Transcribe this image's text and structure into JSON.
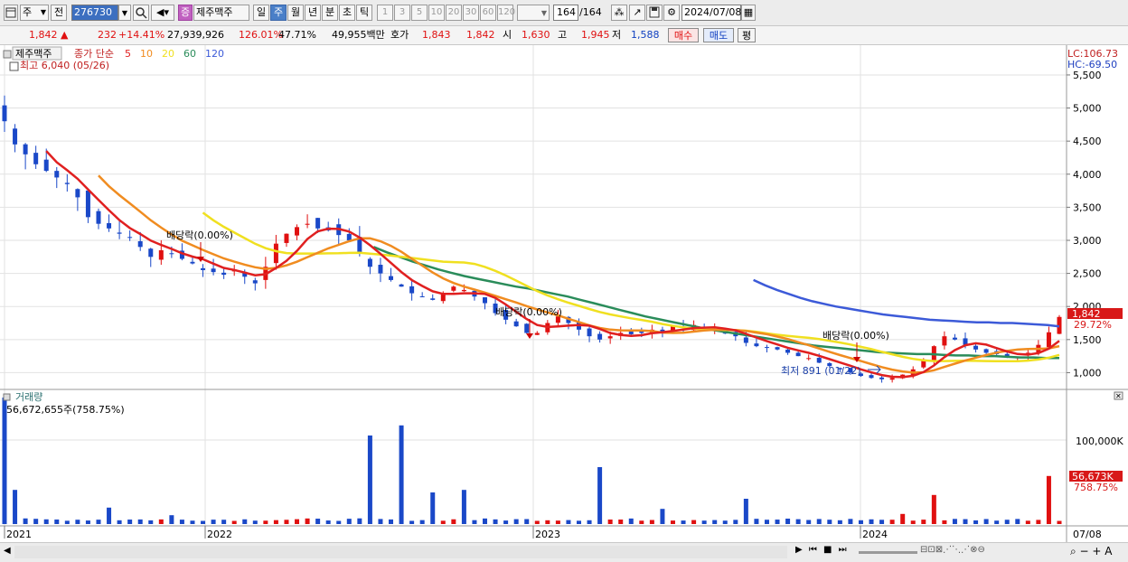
{
  "toolbar": {
    "market_select": "주",
    "prev_label": "전",
    "code": "276730",
    "stock_tag": "증",
    "stock_name": "제주맥주",
    "period_tabs": [
      "일",
      "주",
      "월",
      "년",
      "분",
      "초",
      "틱"
    ],
    "active_period": "주",
    "interval_buttons": [
      "1",
      "3",
      "5",
      "10",
      "20",
      "30",
      "60",
      "120"
    ],
    "count_value": "164",
    "count_total": "/164",
    "date_value": "2024/07/08"
  },
  "quote": {
    "price": "1,842",
    "change_arrow": "▲",
    "change": "232",
    "change_pct": "+14.41%",
    "volume": "27,939,926",
    "volume_ratio": "126.01%",
    "turnover_ratio": "47.71%",
    "amount": "49,955백만",
    "hoga_label": "호가",
    "ask": "1,843",
    "bid": "1,842",
    "open_label": "시",
    "open": "1,630",
    "high_label": "고",
    "high": "1,945",
    "low_label": "저",
    "low": "1,588",
    "buy_label": "매수",
    "sell_label": "매도",
    "eval_label": "평"
  },
  "chart_data": {
    "type": "candlestick",
    "price_panel": {
      "stock_label": "제주맥주",
      "ma_label": "종가 단순",
      "ma_periods": [
        "5",
        "10",
        "20",
        "60",
        "120"
      ],
      "ma_colors": [
        "#e02020",
        "#f08c20",
        "#f0e020",
        "#2a8c5a",
        "#3c5ad8"
      ],
      "high_note": "최고 6,040 (05/26)",
      "low_note": "최저 891 (01/22)",
      "events": [
        {
          "label": "배당락(0.00%)",
          "x": "2021-09"
        },
        {
          "label": "배당락(0.00%)",
          "x": "2022-12"
        },
        {
          "label": "배당락(0.00%)",
          "x": "2023-12"
        }
      ],
      "lc": "LC:106.73",
      "hc": "HC:-69.50",
      "price_tag": "1,842",
      "pct_tag": "29.72%",
      "y_ticks": [
        "5,500",
        "5,000",
        "4,500",
        "4,000",
        "3,500",
        "3,000",
        "2,500",
        "2,000",
        "1,500",
        "1,000"
      ],
      "ylim": [
        760,
        5950
      ],
      "close_series": [
        4800,
        4450,
        4300,
        4150,
        4050,
        3950,
        3850,
        3650,
        3350,
        3250,
        3180,
        3100,
        3050,
        2900,
        2750,
        2850,
        2800,
        2720,
        2650,
        2550,
        2520,
        2480,
        2560,
        2450,
        2350,
        2600,
        2950,
        3100,
        3200,
        3250,
        3180,
        3150,
        3080,
        3000,
        2800,
        2600,
        2500,
        2400,
        2300,
        2200,
        2150,
        2100,
        2200,
        2300,
        2250,
        2150,
        2050,
        1900,
        1800,
        1700,
        1600,
        1600,
        1750,
        1850,
        1750,
        1650,
        1550,
        1500,
        1550,
        1600,
        1580,
        1600,
        1650,
        1620,
        1700,
        1680,
        1720,
        1680,
        1650,
        1600,
        1550,
        1450,
        1400,
        1380,
        1350,
        1300,
        1250,
        1220,
        1150,
        1100,
        1050,
        1000,
        950,
        920,
        900,
        920,
        970,
        1050,
        1200,
        1400,
        1550,
        1500,
        1420,
        1350,
        1300,
        1280,
        1250,
        1230,
        1300,
        1420,
        1610,
        1842
      ],
      "ma5": [
        3600,
        3500,
        3380,
        3250,
        3120,
        3000,
        2920,
        2860,
        2800,
        2750,
        2700,
        2650,
        2600,
        2560,
        2520,
        2480,
        2440,
        2420,
        2550,
        2800,
        2950,
        3050,
        3120,
        3150,
        3100,
        3050,
        2980,
        2900,
        2800,
        2680,
        2550,
        2420,
        2300,
        2200,
        2150,
        2180,
        2200,
        2180,
        2100,
        2000,
        1900,
        1780,
        1700,
        1680,
        1700,
        1730,
        1700,
        1650,
        1600,
        1580,
        1600,
        1630,
        1660,
        1680,
        1700,
        1680,
        1640,
        1590,
        1540,
        1480,
        1420,
        1360,
        1300,
        1260,
        1210,
        1160,
        1110,
        1060,
        1020,
        980,
        950,
        930,
        940,
        1000,
        1100,
        1250,
        1400,
        1480,
        1450,
        1380,
        1320,
        1280,
        1260,
        1280,
        1400,
        1600
      ],
      "ma60": [
        2900,
        2820,
        2750,
        2680,
        2620,
        2560,
        2510,
        2460,
        2420,
        2380,
        2340,
        2300,
        2270,
        2230,
        2190,
        2150,
        2100,
        2050,
        2000,
        1950,
        1900,
        1850,
        1810,
        1770,
        1730,
        1690,
        1650,
        1620,
        1590,
        1560,
        1530,
        1500,
        1470,
        1440,
        1410,
        1390,
        1370,
        1350,
        1330,
        1310,
        1300,
        1290,
        1280,
        1280,
        1270,
        1260,
        1260,
        1250,
        1250,
        1240,
        1230,
        1230,
        1220,
        1220
      ],
      "ma120": [
        2400,
        2320,
        2250,
        2190,
        2130,
        2080,
        2040,
        2000,
        1970,
        1940,
        1910,
        1880,
        1860,
        1840,
        1820,
        1800,
        1790,
        1780,
        1770,
        1760,
        1760,
        1750,
        1750,
        1740,
        1730,
        1720,
        1700
      ]
    },
    "volume_panel": {
      "label": "거래량",
      "current": "56,672,655주(758.75%)",
      "y_ticks": [
        "100,000K"
      ],
      "volume_tag": "56,673K",
      "volume_pct_tag": "758.75%"
    },
    "x_ticks": [
      "2021",
      "2022",
      "2023",
      "2024"
    ],
    "x_end_label": "07/08"
  }
}
